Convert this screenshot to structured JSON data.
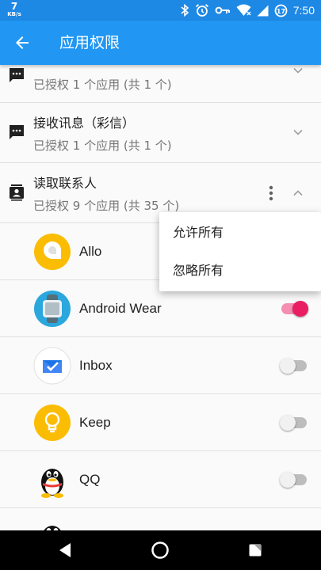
{
  "status_bar": {
    "speed_value": "7",
    "speed_unit": "KB/s",
    "time": "7:50"
  },
  "app_bar": {
    "title": "应用权限",
    "back_icon": "arrow-back-icon"
  },
  "groups": [
    {
      "title": "",
      "subtitle": "已授权 1 个应用 (共 1 个)",
      "icon": "message-icon",
      "expanded": false
    },
    {
      "title": "接收讯息（彩信）",
      "subtitle": "已授权 1 个应用 (共 1 个)",
      "icon": "message-icon",
      "expanded": false
    },
    {
      "title": "读取联系人",
      "subtitle": "已授权 9 个应用 (共 35 个)",
      "icon": "contacts-icon",
      "expanded": true
    }
  ],
  "apps": [
    {
      "name": "Allo",
      "icon": "allo-icon",
      "enabled": false
    },
    {
      "name": "Android Wear",
      "icon": "android-wear-icon",
      "enabled": true
    },
    {
      "name": "Inbox",
      "icon": "inbox-icon",
      "enabled": false
    },
    {
      "name": "Keep",
      "icon": "keep-icon",
      "enabled": false
    },
    {
      "name": "QQ",
      "icon": "qq-icon",
      "enabled": false
    }
  ],
  "menu": {
    "allow_all": "允许所有",
    "ignore_all": "忽略所有"
  },
  "colors": {
    "app_bar": "#2196f3",
    "status_bar": "#1e88e5",
    "switch_on": "#e91e63"
  }
}
